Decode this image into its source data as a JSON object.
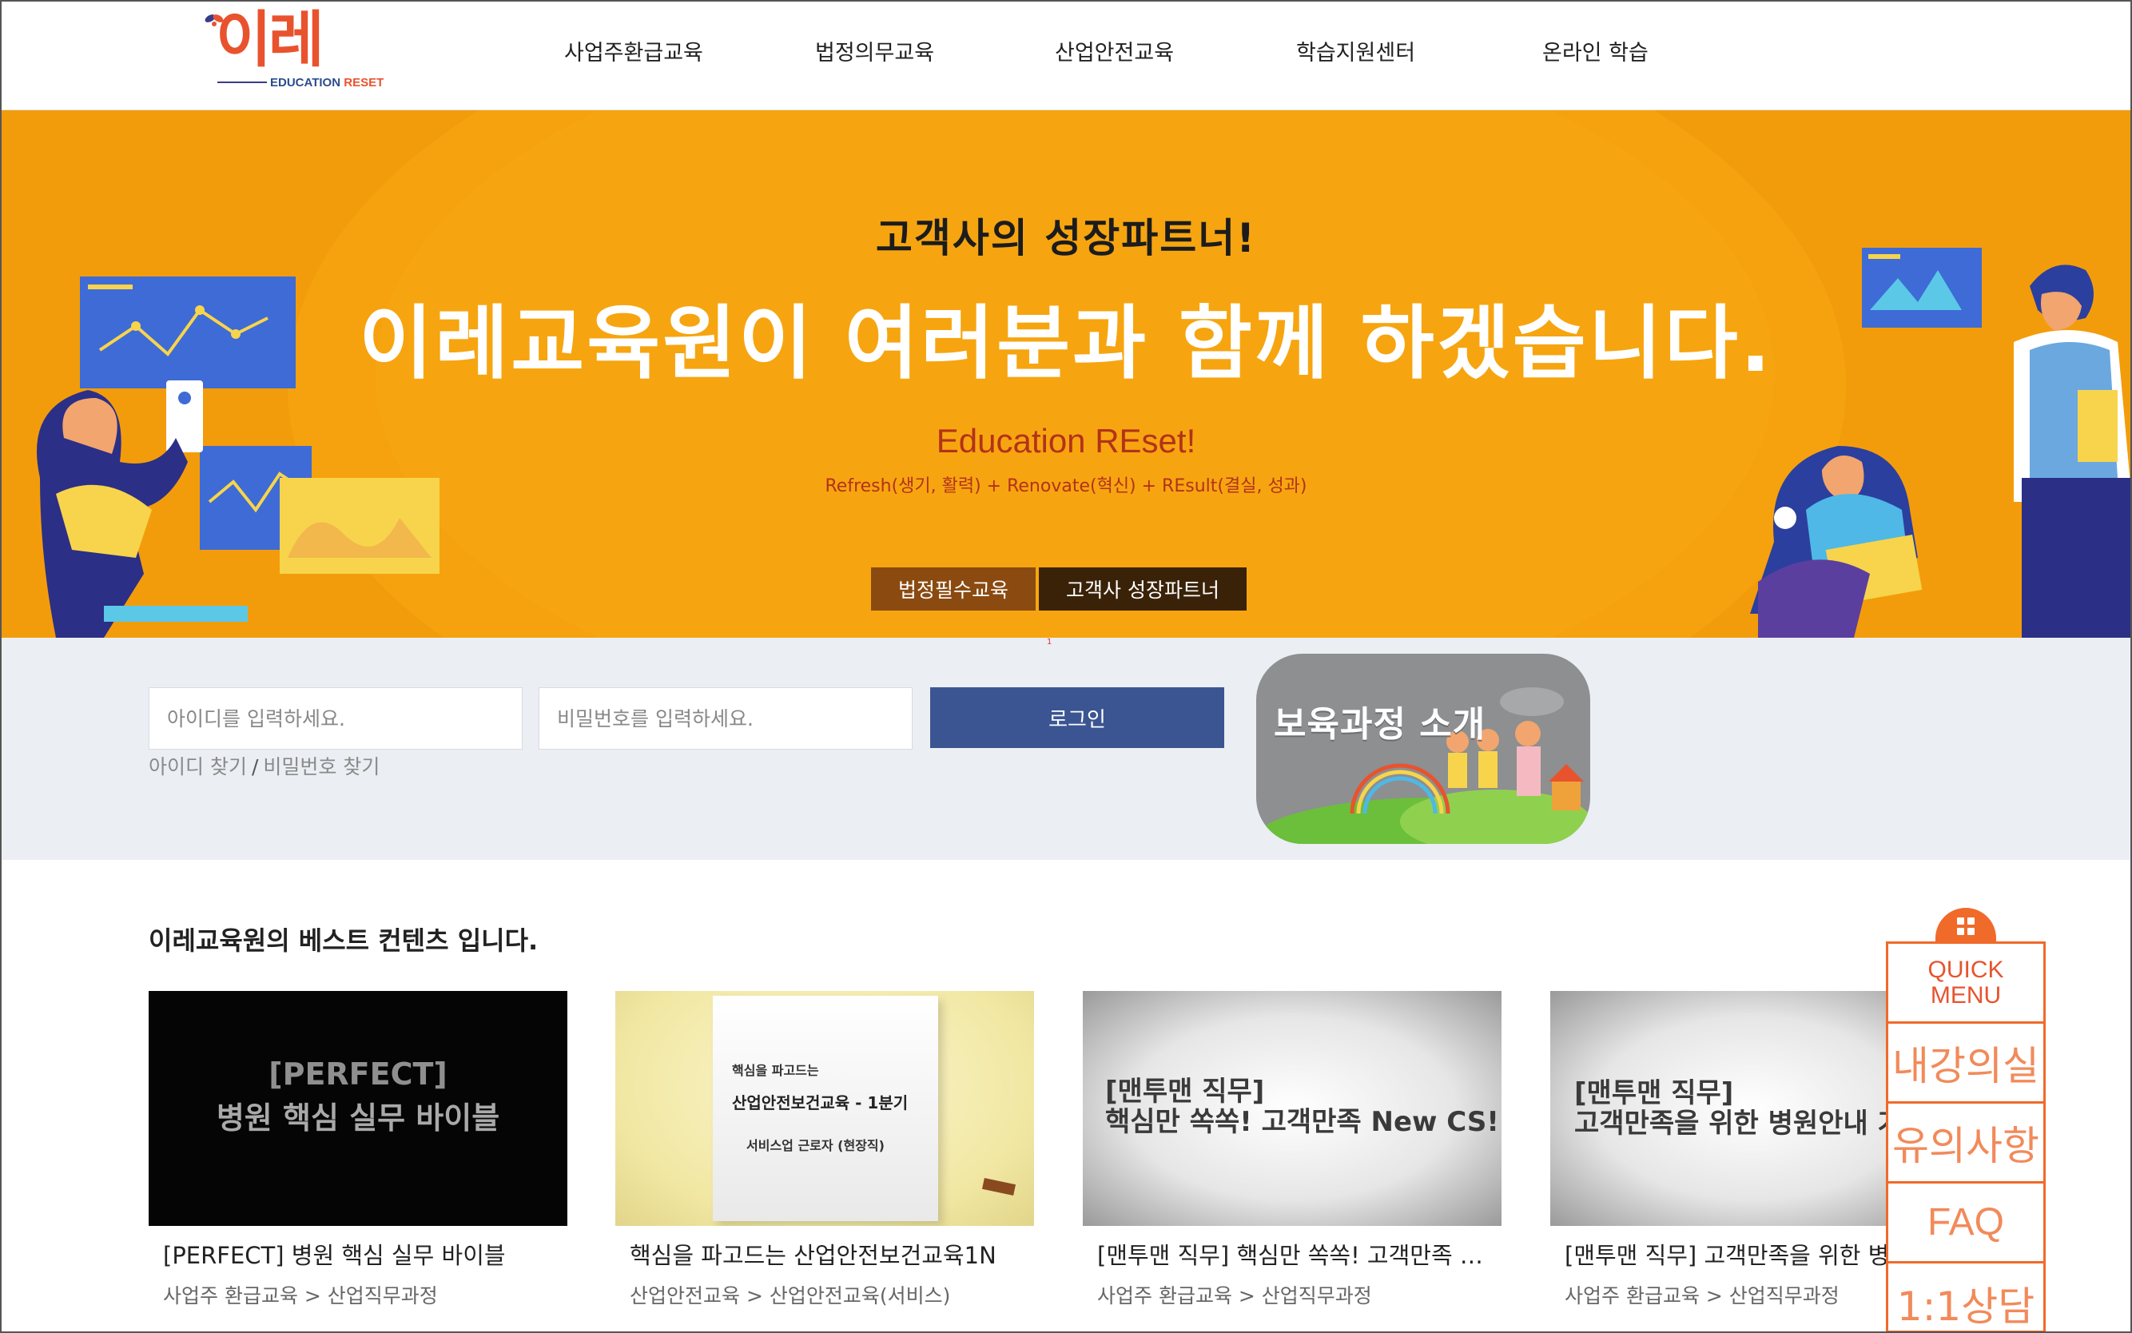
{
  "brand": {
    "logo_text": "이레",
    "logo_sub_a": "EDUCATION ",
    "logo_sub_b": "RESET"
  },
  "nav": {
    "items": [
      "사업주환급교육",
      "법정의무교육",
      "산업안전교육",
      "학습지원센터",
      "온라인 학습"
    ]
  },
  "hero": {
    "subtitle": "고객사의 성장파트너!",
    "title": "이레교육원이 여러분과 함께 하겠습니다.",
    "brand_line": "Education REset!",
    "description": "Refresh(생기, 활력) + Renovate(혁신) + REsult(결실, 성과)",
    "tabs": [
      "법정필수교육",
      "고객사 성장파트너"
    ],
    "slide_indicator": "1"
  },
  "login": {
    "id_placeholder": "아이디를 입력하세요.",
    "pw_placeholder": "비밀번호를 입력하세요.",
    "button_label": "로그인",
    "find_id": "아이디 찾기",
    "separator": "/",
    "find_pw": "비밀번호 찾기"
  },
  "promo": {
    "title": "보육과정 소개"
  },
  "best": {
    "section_title": "이레교육원의 베스트 컨텐츠 입니다.",
    "cards": [
      {
        "thumb_line1": "[PERFECT]",
        "thumb_line2": "병원 핵심 실무 바이블",
        "title": "[PERFECT] 병원 핵심 실무 바이블",
        "category": "사업주 환급교육 > 산업직무과정"
      },
      {
        "thumb_line1": "핵심을 파고드는",
        "thumb_line2": "산업안전보건교육 - 1분기",
        "thumb_line3": "서비스업 근로자 (현장직)",
        "title": "핵심을 파고드는 산업안전보건교육1N",
        "category": "산업안전교육 > 산업안전교육(서비스)"
      },
      {
        "thumb_line1": "[맨투맨 직무]",
        "thumb_line2": "핵심만 쏙쏙! 고객만족 New CS!",
        "title": "[맨투맨 직무] 핵심만 쏙쏙! 고객만족 …",
        "category": "사업주 환급교육 > 산업직무과정"
      },
      {
        "thumb_line1": "[맨투맨 직무]",
        "thumb_line2": "고객만족을 위한 병원안내 가",
        "title": "[맨투맨 직무] 고객만족을 위한 병원",
        "category": "사업주 환급교육 > 산업직무과정"
      }
    ]
  },
  "quick_menu": {
    "head_line1": "QUICK",
    "head_line2": "MENU",
    "items": [
      "내강의실",
      "유의사항",
      "FAQ",
      "1:1상담"
    ]
  },
  "colors": {
    "hero_orange": "#f39c0b",
    "brand_red": "#e8532e",
    "login_blue": "#3b5592",
    "quick_orange": "#f06a2a"
  }
}
